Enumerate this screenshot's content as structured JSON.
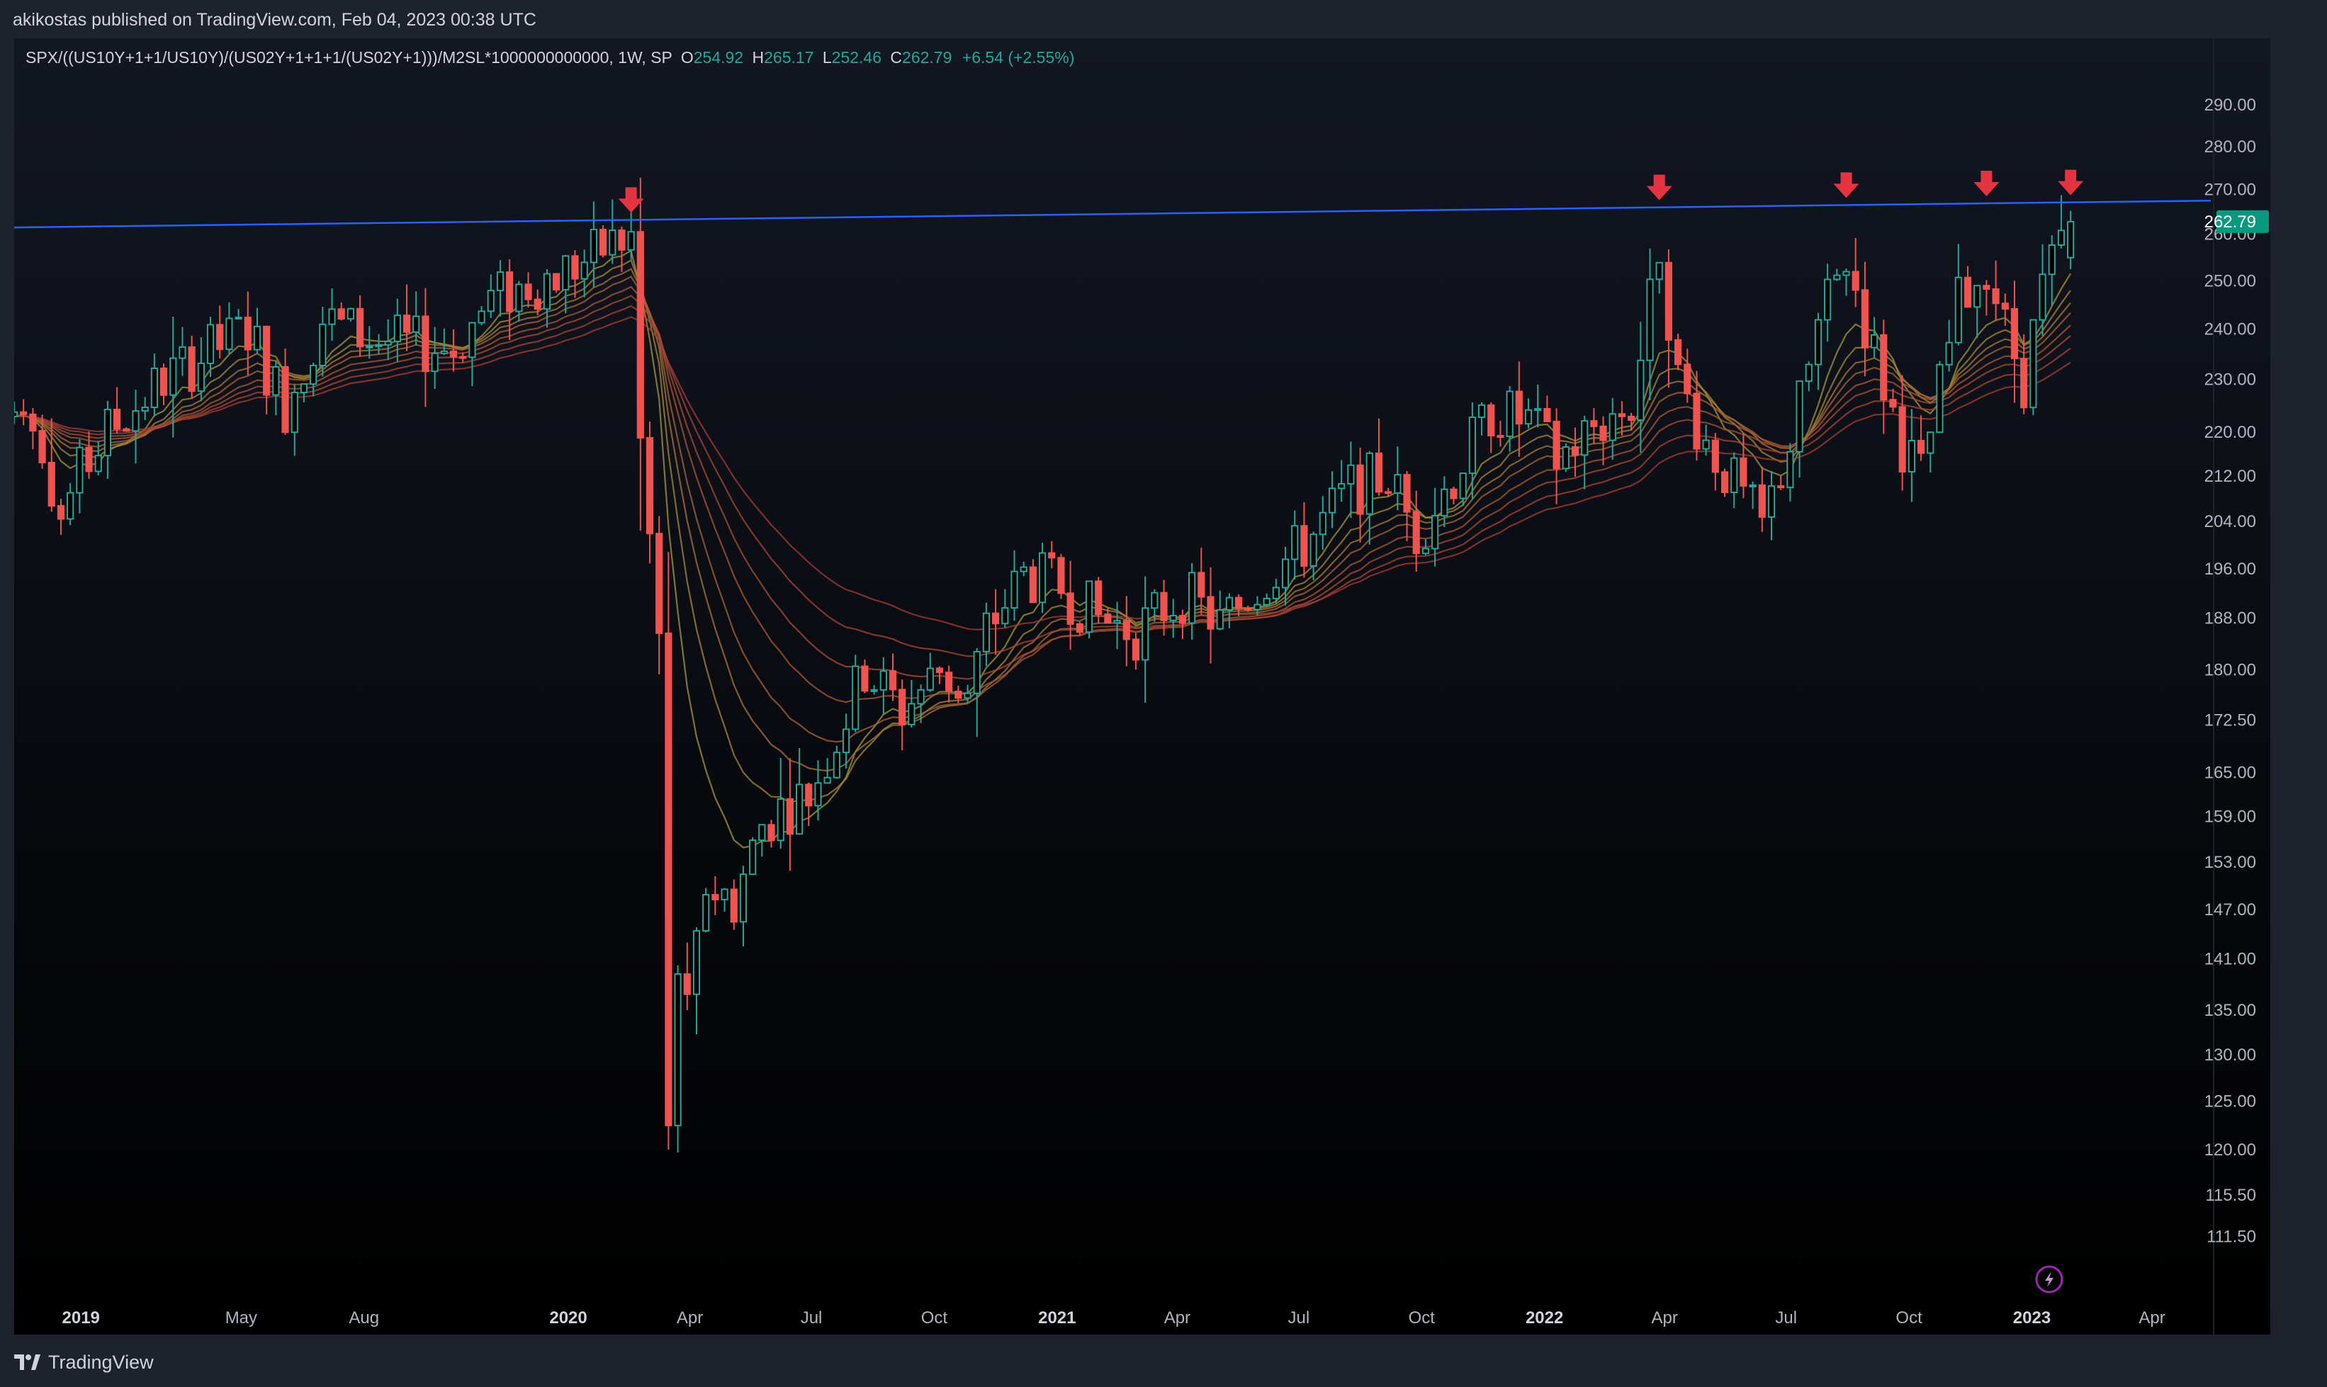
{
  "header": {
    "published_by": "akikostas published on TradingView.com, Feb 04, 2023 00:38 UTC"
  },
  "legend": {
    "symbol": "SPX/((US10Y+1+1/US10Y)/(US02Y+1+1+1/(US02Y+1)))/M2SL*1000000000000, 1W, SP",
    "open_label": "O",
    "open": "254.92",
    "high_label": "H",
    "high": "265.17",
    "low_label": "L",
    "low": "252.46",
    "close_label": "C",
    "close": "262.79",
    "change": "+6.54 (+2.55%)"
  },
  "footer": {
    "brand": "TradingView"
  },
  "colors": {
    "up": "#26a69a",
    "down": "#ef5350",
    "trendline": "#2962ff",
    "arrow": "#e53342",
    "price_tag": "#089981",
    "ribbon_fast": "#9a9a3a",
    "ribbon_slow": "#b0463c"
  },
  "chart_data": {
    "type": "candlestick",
    "title": "SPX/((US10Y+1+1/US10Y)/(US02Y+1+1+1/(US02Y+1)))/M2SL*1000000000000",
    "interval": "1W",
    "y_scale": "log",
    "ylim": [
      108,
      296
    ],
    "xlim": [
      "2018-11-12",
      "2023-05-15"
    ],
    "y_ticks": [
      "290.00",
      "280.00",
      "270.00",
      "260.00",
      "250.00",
      "240.00",
      "230.00",
      "220.00",
      "212.00",
      "204.00",
      "196.00",
      "188.00",
      "180.00",
      "172.50",
      "165.00",
      "159.00",
      "153.00",
      "147.00",
      "141.00",
      "135.00",
      "130.00",
      "125.00",
      "120.00",
      "115.50",
      "111.50"
    ],
    "x_ticks": [
      {
        "label": "2019",
        "date": "2019-01-01",
        "bold": true
      },
      {
        "label": "May",
        "date": "2019-05-01",
        "bold": false
      },
      {
        "label": "Aug",
        "date": "2019-08-01",
        "bold": false
      },
      {
        "label": "2020",
        "date": "2020-01-01",
        "bold": true
      },
      {
        "label": "Apr",
        "date": "2020-04-01",
        "bold": false
      },
      {
        "label": "Jul",
        "date": "2020-07-01",
        "bold": false
      },
      {
        "label": "Oct",
        "date": "2020-10-01",
        "bold": false
      },
      {
        "label": "2021",
        "date": "2021-01-01",
        "bold": true
      },
      {
        "label": "Apr",
        "date": "2021-04-01",
        "bold": false
      },
      {
        "label": "Jul",
        "date": "2021-07-01",
        "bold": false
      },
      {
        "label": "Oct",
        "date": "2021-10-01",
        "bold": false
      },
      {
        "label": "2022",
        "date": "2022-01-01",
        "bold": true
      },
      {
        "label": "Apr",
        "date": "2022-04-01",
        "bold": false
      },
      {
        "label": "Jul",
        "date": "2022-07-01",
        "bold": false
      },
      {
        "label": "Oct",
        "date": "2022-10-01",
        "bold": false
      },
      {
        "label": "2023",
        "date": "2023-01-01",
        "bold": true
      },
      {
        "label": "Apr",
        "date": "2023-04-01",
        "bold": false
      }
    ],
    "last_price": "262.79",
    "trendline": {
      "from": {
        "date": "2018-11-12",
        "value": 261.5
      },
      "to": {
        "date": "2023-05-15",
        "value": 267.5
      }
    },
    "top_arrows": [
      "2020-02-17",
      "2022-03-28",
      "2022-08-15",
      "2022-11-28",
      "2023-01-30"
    ],
    "ribbon": {
      "lines": 8,
      "kind": "moving-average ribbon"
    },
    "anchors": [
      [
        "2018-11-05",
        223
      ],
      [
        "2018-11-26",
        225
      ],
      [
        "2018-12-17",
        205
      ],
      [
        "2018-12-31",
        212
      ],
      [
        "2019-01-21",
        220
      ],
      [
        "2019-03-04",
        230
      ],
      [
        "2019-05-06",
        240
      ],
      [
        "2019-06-03",
        225
      ],
      [
        "2019-07-01",
        242
      ],
      [
        "2019-08-05",
        238
      ],
      [
        "2019-09-02",
        237
      ],
      [
        "2019-10-07",
        236
      ],
      [
        "2019-11-04",
        246
      ],
      [
        "2019-12-09",
        250
      ],
      [
        "2020-01-13",
        254
      ],
      [
        "2020-02-03",
        258
      ],
      [
        "2020-02-17",
        259
      ],
      [
        "2020-02-24",
        218
      ],
      [
        "2020-03-09",
        185
      ],
      [
        "2020-03-16",
        121
      ],
      [
        "2020-03-23",
        140
      ],
      [
        "2020-03-30",
        134
      ],
      [
        "2020-04-13",
        150
      ],
      [
        "2020-05-04",
        148
      ],
      [
        "2020-05-25",
        158
      ],
      [
        "2020-06-08",
        160
      ],
      [
        "2020-06-29",
        162
      ],
      [
        "2020-07-20",
        170
      ],
      [
        "2020-08-10",
        180
      ],
      [
        "2020-09-07",
        174
      ],
      [
        "2020-10-05",
        180
      ],
      [
        "2020-10-26",
        176
      ],
      [
        "2020-11-09",
        186
      ],
      [
        "2020-12-07",
        195
      ],
      [
        "2021-01-04",
        193
      ],
      [
        "2021-02-01",
        188
      ],
      [
        "2021-03-01",
        186
      ],
      [
        "2021-04-05",
        192
      ],
      [
        "2021-05-03",
        187
      ],
      [
        "2021-06-07",
        195
      ],
      [
        "2021-07-05",
        200
      ],
      [
        "2021-08-09",
        210
      ],
      [
        "2021-09-06",
        212
      ],
      [
        "2021-09-27",
        202
      ],
      [
        "2021-10-25",
        212
      ],
      [
        "2021-11-22",
        224
      ],
      [
        "2021-12-20",
        222
      ],
      [
        "2022-01-10",
        215
      ],
      [
        "2022-02-07",
        221
      ],
      [
        "2022-03-07",
        225
      ],
      [
        "2022-03-21",
        245
      ],
      [
        "2022-03-28",
        258
      ],
      [
        "2022-04-11",
        230
      ],
      [
        "2022-05-02",
        218
      ],
      [
        "2022-06-13",
        203
      ],
      [
        "2022-07-04",
        218
      ],
      [
        "2022-07-25",
        240
      ],
      [
        "2022-08-15",
        255
      ],
      [
        "2022-09-05",
        235
      ],
      [
        "2022-09-26",
        218
      ],
      [
        "2022-10-10",
        212
      ],
      [
        "2022-10-24",
        228
      ],
      [
        "2022-11-07",
        245
      ],
      [
        "2022-11-28",
        254
      ],
      [
        "2022-12-12",
        240
      ],
      [
        "2022-12-26",
        230
      ],
      [
        "2023-01-09",
        248
      ],
      [
        "2023-01-30",
        262.79
      ]
    ]
  }
}
